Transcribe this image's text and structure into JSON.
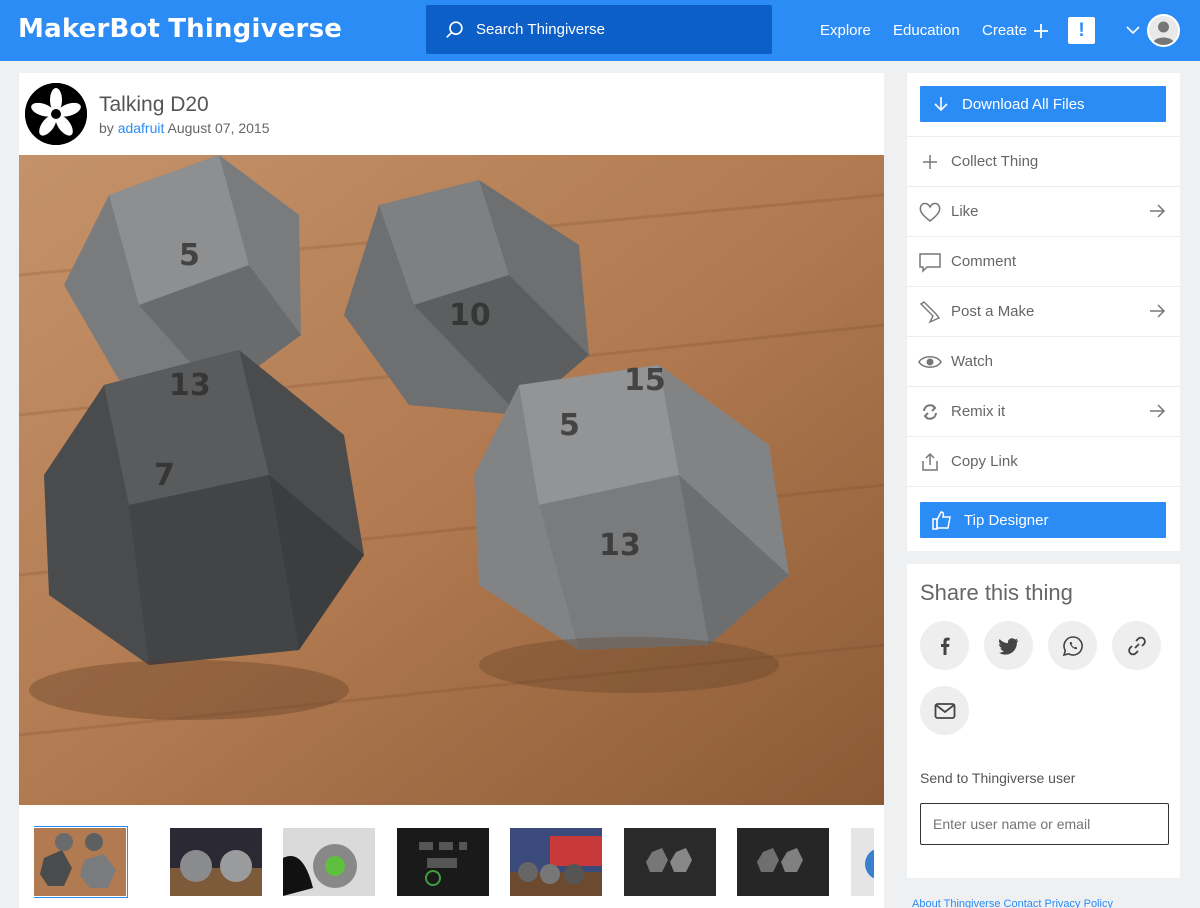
{
  "header": {
    "logo_brand": "MakerBot",
    "logo_product": "Thingiverse",
    "search_placeholder": "Search Thingiverse",
    "nav": {
      "explore": "Explore",
      "education": "Education",
      "create": "Create"
    },
    "alert_symbol": "!",
    "brand_color": "#2b8cf5"
  },
  "thing": {
    "title": "Talking D20",
    "by": "by",
    "author": "adafruit",
    "date": "August 07, 2015"
  },
  "gallery": {
    "thumbnail_count": 8,
    "selected_index": 0
  },
  "actions": {
    "download_all": "Download All Files",
    "collect": "Collect Thing",
    "like": "Like",
    "comment": "Comment",
    "post_make": "Post a Make",
    "watch": "Watch",
    "remix": "Remix it",
    "copy_link": "Copy Link",
    "tip_designer": "Tip Designer"
  },
  "share": {
    "title": "Share this thing",
    "icons": [
      "facebook-icon",
      "twitter-icon",
      "whatsapp-icon",
      "link-icon",
      "email-icon"
    ],
    "send_label": "Send to Thingiverse user",
    "user_placeholder": "Enter user name or email"
  },
  "footer": {
    "links_text": "About Thingiverse   Contact   Privacy Policy"
  }
}
